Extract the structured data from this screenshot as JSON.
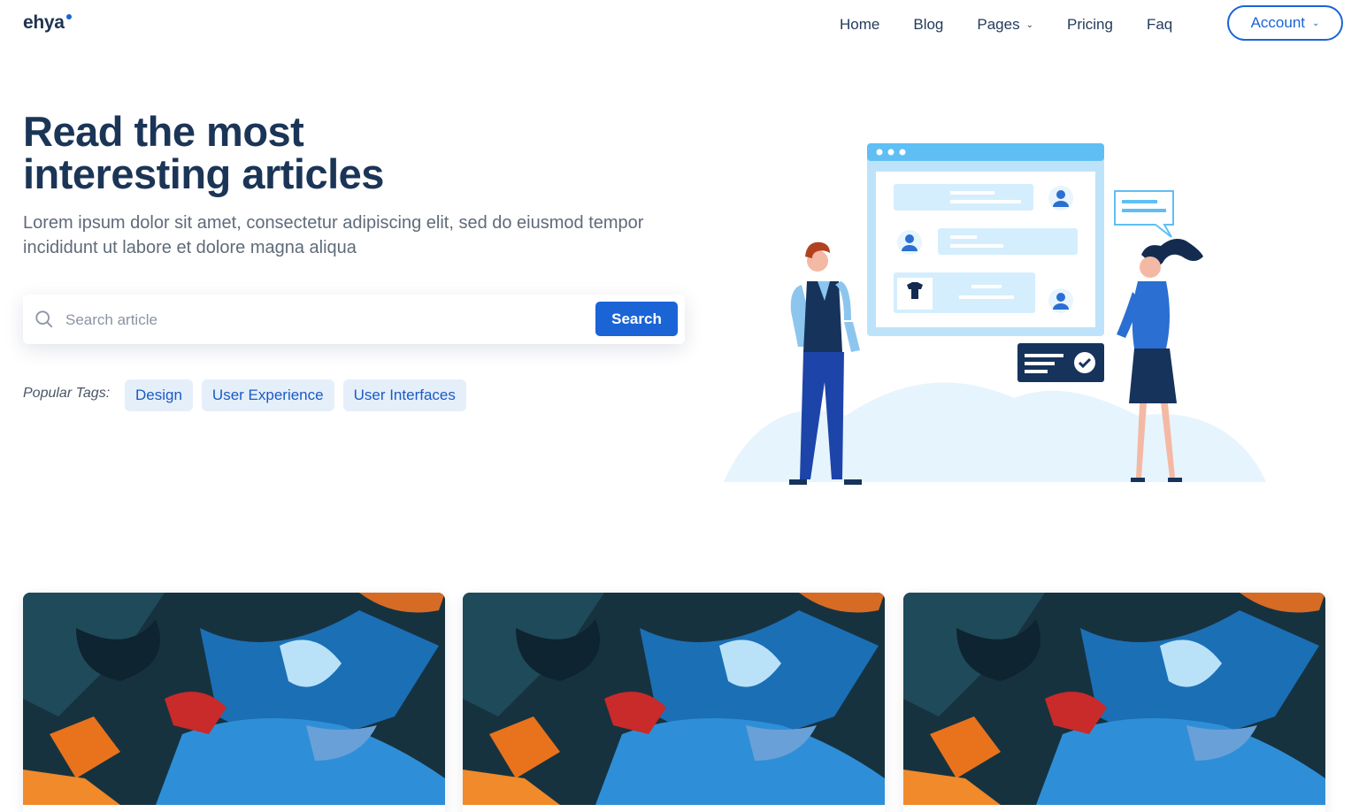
{
  "header": {
    "logo": "ehya",
    "nav": [
      {
        "label": "Home"
      },
      {
        "label": "Blog"
      },
      {
        "label": "Pages",
        "has_dropdown": true
      },
      {
        "label": "Pricing"
      },
      {
        "label": "Faq"
      }
    ],
    "account_label": "Account"
  },
  "hero": {
    "title_line1": "Read the most",
    "title_line2": "interesting articles",
    "subtitle": "Lorem ipsum dolor sit amet, consectetur adipiscing elit, sed do eiusmod tempor incididunt ut labore et dolore magna aliqua",
    "search": {
      "placeholder": "Search article",
      "value": "",
      "button_label": "Search"
    },
    "tags_label": "Popular Tags:",
    "tags": [
      "Design",
      "User Experience",
      "User Interfaces"
    ]
  },
  "icons": {
    "search": "search-icon",
    "chevron": "chevron-down-icon"
  },
  "colors": {
    "accent": "#1a64d6",
    "heading": "#1b3557",
    "tag_bg": "#e5effa"
  },
  "cards": [
    {
      "image": "abstract-painting"
    },
    {
      "image": "abstract-painting"
    },
    {
      "image": "abstract-painting"
    }
  ]
}
